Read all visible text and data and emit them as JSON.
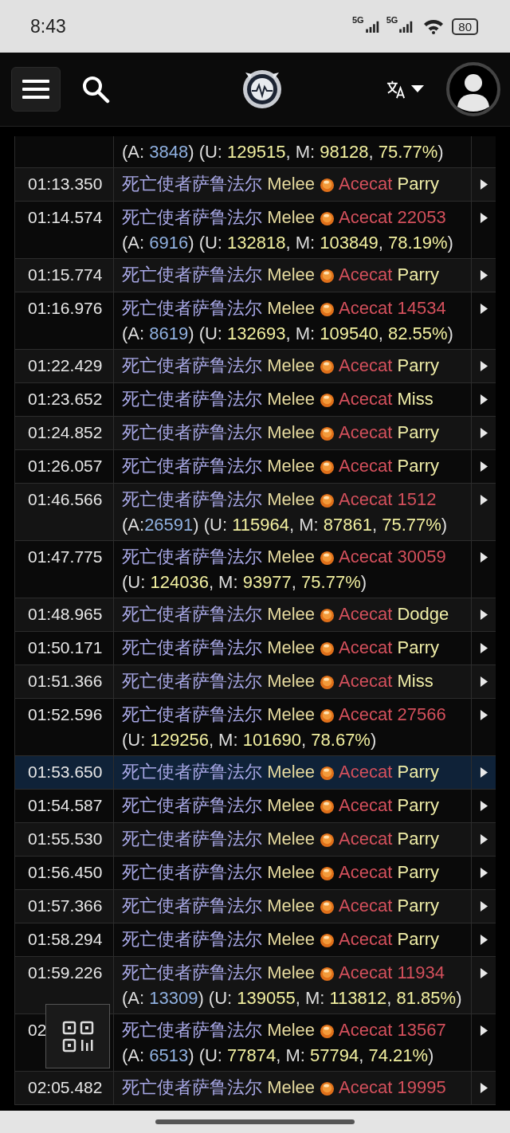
{
  "status_bar": {
    "time": "8:43",
    "network_1": "5G",
    "network_2": "5G",
    "battery": "80"
  },
  "log": [
    {
      "selected": false,
      "detail": [
        {
          "text": "(A: ",
          "kind": "plain"
        },
        {
          "text": "3848",
          "kind": "absorb"
        },
        {
          "text": ") (U: ",
          "kind": "plain"
        },
        {
          "text": "129515",
          "kind": "value"
        },
        {
          "text": ", M: ",
          "kind": "plain"
        },
        {
          "text": "98128",
          "kind": "value"
        },
        {
          "text": ", ",
          "kind": "plain"
        },
        {
          "text": "75.77%",
          "kind": "value"
        },
        {
          "text": ")",
          "kind": "plain"
        }
      ]
    },
    {
      "time": "01:13.350",
      "selected": false,
      "source": "死亡使者萨鲁法尔",
      "ability": "Melee",
      "target": "Acecat",
      "result": "Parry",
      "kind": "avoid"
    },
    {
      "time": "01:14.574",
      "selected": false,
      "source": "死亡使者萨鲁法尔",
      "ability": "Melee",
      "target": "Acecat",
      "result": "22053",
      "kind": "damage",
      "detail": [
        {
          "text": "(A: ",
          "kind": "plain"
        },
        {
          "text": "6916",
          "kind": "absorb"
        },
        {
          "text": ") (U: ",
          "kind": "plain"
        },
        {
          "text": "132818",
          "kind": "value"
        },
        {
          "text": ", M: ",
          "kind": "plain"
        },
        {
          "text": "103849",
          "kind": "value"
        },
        {
          "text": ", ",
          "kind": "plain"
        },
        {
          "text": "78.19%",
          "kind": "value"
        },
        {
          "text": ")",
          "kind": "plain"
        }
      ]
    },
    {
      "time": "01:15.774",
      "selected": false,
      "source": "死亡使者萨鲁法尔",
      "ability": "Melee",
      "target": "Acecat",
      "result": "Parry",
      "kind": "avoid"
    },
    {
      "time": "01:16.976",
      "selected": false,
      "source": "死亡使者萨鲁法尔",
      "ability": "Melee",
      "target": "Acecat",
      "result": "14534",
      "kind": "damage",
      "detail": [
        {
          "text": "(A: ",
          "kind": "plain"
        },
        {
          "text": "8619",
          "kind": "absorb"
        },
        {
          "text": ") (U: ",
          "kind": "plain"
        },
        {
          "text": "132693",
          "kind": "value"
        },
        {
          "text": ", M: ",
          "kind": "plain"
        },
        {
          "text": "109540",
          "kind": "value"
        },
        {
          "text": ", ",
          "kind": "plain"
        },
        {
          "text": "82.55%",
          "kind": "value"
        },
        {
          "text": ")",
          "kind": "plain"
        }
      ]
    },
    {
      "time": "01:22.429",
      "selected": false,
      "source": "死亡使者萨鲁法尔",
      "ability": "Melee",
      "target": "Acecat",
      "result": "Parry",
      "kind": "avoid"
    },
    {
      "time": "01:23.652",
      "selected": false,
      "source": "死亡使者萨鲁法尔",
      "ability": "Melee",
      "target": "Acecat",
      "result": "Miss",
      "kind": "avoid"
    },
    {
      "time": "01:24.852",
      "selected": false,
      "source": "死亡使者萨鲁法尔",
      "ability": "Melee",
      "target": "Acecat",
      "result": "Parry",
      "kind": "avoid"
    },
    {
      "time": "01:26.057",
      "selected": false,
      "source": "死亡使者萨鲁法尔",
      "ability": "Melee",
      "target": "Acecat",
      "result": "Parry",
      "kind": "avoid"
    },
    {
      "time": "01:46.566",
      "selected": false,
      "source": "死亡使者萨鲁法尔",
      "ability": "Melee",
      "target": "Acecat",
      "result": "1512",
      "kind": "damage",
      "detail": [
        {
          "text": "(A:",
          "kind": "plain"
        },
        {
          "text": "26591",
          "kind": "absorb"
        },
        {
          "text": ") (U: ",
          "kind": "plain"
        },
        {
          "text": "115964",
          "kind": "value"
        },
        {
          "text": ", M: ",
          "kind": "plain"
        },
        {
          "text": "87861",
          "kind": "value"
        },
        {
          "text": ", ",
          "kind": "plain"
        },
        {
          "text": "75.77%",
          "kind": "value"
        },
        {
          "text": ")",
          "kind": "plain"
        }
      ]
    },
    {
      "time": "01:47.775",
      "selected": false,
      "source": "死亡使者萨鲁法尔",
      "ability": "Melee",
      "target": "Acecat",
      "result": "30059",
      "kind": "damage",
      "detail": [
        {
          "text": "(U: ",
          "kind": "plain"
        },
        {
          "text": "124036",
          "kind": "value"
        },
        {
          "text": ", M: ",
          "kind": "plain"
        },
        {
          "text": "93977",
          "kind": "value"
        },
        {
          "text": ", ",
          "kind": "plain"
        },
        {
          "text": "75.77%",
          "kind": "value"
        },
        {
          "text": ")",
          "kind": "plain"
        }
      ]
    },
    {
      "time": "01:48.965",
      "selected": false,
      "source": "死亡使者萨鲁法尔",
      "ability": "Melee",
      "target": "Acecat",
      "result": "Dodge",
      "kind": "avoid"
    },
    {
      "time": "01:50.171",
      "selected": false,
      "source": "死亡使者萨鲁法尔",
      "ability": "Melee",
      "target": "Acecat",
      "result": "Parry",
      "kind": "avoid"
    },
    {
      "time": "01:51.366",
      "selected": false,
      "source": "死亡使者萨鲁法尔",
      "ability": "Melee",
      "target": "Acecat",
      "result": "Miss",
      "kind": "avoid"
    },
    {
      "time": "01:52.596",
      "selected": false,
      "source": "死亡使者萨鲁法尔",
      "ability": "Melee",
      "target": "Acecat",
      "result": "27566",
      "kind": "damage",
      "detail": [
        {
          "text": "(U: ",
          "kind": "plain"
        },
        {
          "text": "129256",
          "kind": "value"
        },
        {
          "text": ", M: ",
          "kind": "plain"
        },
        {
          "text": "101690",
          "kind": "value"
        },
        {
          "text": ", ",
          "kind": "plain"
        },
        {
          "text": "78.67%",
          "kind": "value"
        },
        {
          "text": ")",
          "kind": "plain"
        }
      ]
    },
    {
      "time": "01:53.650",
      "selected": true,
      "source": "死亡使者萨鲁法尔",
      "ability": "Melee",
      "target": "Acecat",
      "result": "Parry",
      "kind": "avoid"
    },
    {
      "time": "01:54.587",
      "selected": false,
      "source": "死亡使者萨鲁法尔",
      "ability": "Melee",
      "target": "Acecat",
      "result": "Parry",
      "kind": "avoid"
    },
    {
      "time": "01:55.530",
      "selected": false,
      "source": "死亡使者萨鲁法尔",
      "ability": "Melee",
      "target": "Acecat",
      "result": "Parry",
      "kind": "avoid"
    },
    {
      "time": "01:56.450",
      "selected": false,
      "source": "死亡使者萨鲁法尔",
      "ability": "Melee",
      "target": "Acecat",
      "result": "Parry",
      "kind": "avoid"
    },
    {
      "time": "01:57.366",
      "selected": false,
      "source": "死亡使者萨鲁法尔",
      "ability": "Melee",
      "target": "Acecat",
      "result": "Parry",
      "kind": "avoid"
    },
    {
      "time": "01:58.294",
      "selected": false,
      "source": "死亡使者萨鲁法尔",
      "ability": "Melee",
      "target": "Acecat",
      "result": "Parry",
      "kind": "avoid"
    },
    {
      "time": "01:59.226",
      "selected": false,
      "source": "死亡使者萨鲁法尔",
      "ability": "Melee",
      "target": "Acecat",
      "result": "11934",
      "kind": "damage",
      "detail": [
        {
          "text": "(A: ",
          "kind": "plain"
        },
        {
          "text": "13309",
          "kind": "absorb"
        },
        {
          "text": ") (U: ",
          "kind": "plain"
        },
        {
          "text": "139055",
          "kind": "value"
        },
        {
          "text": ", M: ",
          "kind": "plain"
        },
        {
          "text": "113812",
          "kind": "value"
        },
        {
          "text": ", ",
          "kind": "plain"
        },
        {
          "text": "81.85%",
          "kind": "value"
        },
        {
          "text": ")",
          "kind": "plain"
        }
      ]
    },
    {
      "time": "02",
      "selected": false,
      "source": "死亡使者萨鲁法尔",
      "ability": "Melee",
      "target": "Acecat",
      "result": "13567",
      "kind": "damage",
      "detail": [
        {
          "text": "(A: ",
          "kind": "plain"
        },
        {
          "text": "6513",
          "kind": "absorb"
        },
        {
          "text": ") (U: ",
          "kind": "plain"
        },
        {
          "text": "77874",
          "kind": "value"
        },
        {
          "text": ", M: ",
          "kind": "plain"
        },
        {
          "text": "57794",
          "kind": "value"
        },
        {
          "text": ", ",
          "kind": "plain"
        },
        {
          "text": "74.21%",
          "kind": "value"
        },
        {
          "text": ")",
          "kind": "plain"
        }
      ]
    },
    {
      "time": "02:05.482",
      "selected": false,
      "source": "死亡使者萨鲁法尔",
      "ability": "Melee",
      "target": "Acecat",
      "result": "19995",
      "kind": "damage"
    }
  ]
}
